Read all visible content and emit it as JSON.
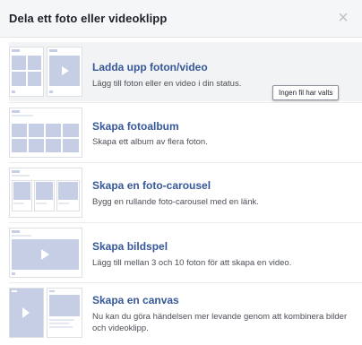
{
  "dialog": {
    "title": "Dela ett foto eller videoklipp",
    "close_symbol": "×"
  },
  "options": [
    {
      "title": "Ladda upp foton/video",
      "description": "Lägg till foton eller en video i din status.",
      "icon": "upload-photo-video-thumbnail"
    },
    {
      "title": "Skapa fotoalbum",
      "description": "Skapa ett album av flera foton.",
      "icon": "photo-album-thumbnail"
    },
    {
      "title": "Skapa en foto-carousel",
      "description": "Bygg en rullande foto-carousel med en länk.",
      "icon": "photo-carousel-thumbnail"
    },
    {
      "title": "Skapa bildspel",
      "description": "Lägg till mellan 3 och 10 foton för att skapa en video.",
      "icon": "slideshow-thumbnail"
    },
    {
      "title": "Skapa en canvas",
      "description": "Nu kan du göra händelsen mer levande genom att kombinera bilder och videoklipp.",
      "icon": "canvas-thumbnail"
    }
  ],
  "tooltip": {
    "text": "Ingen fil har valts"
  },
  "colors": {
    "link": "#365899",
    "thumb_fill": "#c5cee5",
    "header_bg": "#f5f6f7",
    "highlight_bg": "#f2f3f5"
  }
}
